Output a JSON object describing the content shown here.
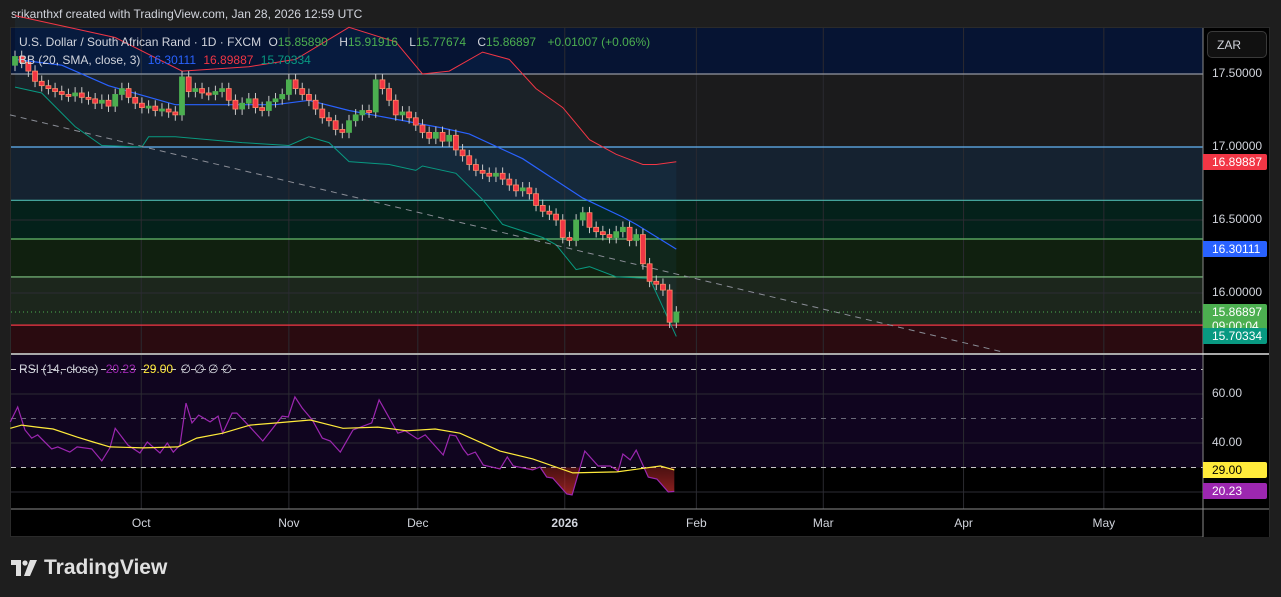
{
  "credit": "srikanthxf created with TradingView.com, Jan 28, 2026 12:59 UTC",
  "logo_text": "TradingView",
  "currency_button": "ZAR",
  "legend": {
    "symbol": "U.S. Dollar / South African Rand · 1D · FXCM",
    "o_label": "O",
    "o": "15.85890",
    "h_label": "H",
    "h": "15.91916",
    "l_label": "L",
    "l": "15.77674",
    "c_label": "C",
    "c": "15.86897",
    "change": "+0.01007 (+0.06%)",
    "bb_label": "BB (20, SMA, close, 3)",
    "bb_basis": "16.30111",
    "bb_upper": "16.89887",
    "bb_lower": "15.70334",
    "rsi_label": "RSI (14, close)",
    "rsi_value": "20.23",
    "rsi_ma": "29.00",
    "rsi_extra": "∅ ∅ ∅ ∅"
  },
  "colors": {
    "up": "#4caf50",
    "down": "#f23645",
    "down_border": "#ff8a65",
    "bb_basis": "#2962ff",
    "bb_upper": "#f23645",
    "bb_lower": "#089981",
    "rsi": "#9c27b0",
    "rsi_ma": "#ffeb3b",
    "last": "#4caf50"
  },
  "price_axis": {
    "ticks": [
      "17.50000",
      "17.00000",
      "16.50000",
      "16.00000"
    ],
    "tick_values": [
      17.5,
      17.0,
      16.5,
      16.0
    ]
  },
  "price_badges": [
    {
      "text": "16.89887",
      "value": 16.89887,
      "color": "#f23645"
    },
    {
      "text": "16.30111",
      "value": 16.30111,
      "color": "#2962ff"
    },
    {
      "text": "15.86897",
      "value": 15.86897,
      "color": "#4caf50",
      "sub": "09:00:04"
    },
    {
      "text": "15.70334",
      "value": 15.70334,
      "color": "#089981"
    }
  ],
  "rsi_axis": {
    "ticks": [
      "60.00",
      "40.00"
    ],
    "tick_values": [
      60,
      40
    ]
  },
  "rsi_badges": [
    {
      "text": "29.00",
      "value": 29.0,
      "color": "#ffeb3b",
      "fg": "#000"
    },
    {
      "text": "20.23",
      "value": 20.23,
      "color": "#9c27b0",
      "fg": "#fff"
    }
  ],
  "time_axis": [
    {
      "label": "Oct",
      "bar": 18.9
    },
    {
      "label": "Nov",
      "bar": 41
    },
    {
      "label": "Dec",
      "bar": 60.3
    },
    {
      "label": "2026",
      "bar": 82.3,
      "bold": true
    },
    {
      "label": "Feb",
      "bar": 102
    },
    {
      "label": "Mar",
      "bar": 121
    },
    {
      "label": "Apr",
      "bar": 142
    },
    {
      "label": "May",
      "bar": 163
    }
  ],
  "chart_data": {
    "type": "candlestick",
    "title": "U.S. Dollar / South African Rand · 1D · FXCM",
    "ylim": [
      15.6,
      17.83
    ],
    "first_open": 17.56,
    "wick": 0.04,
    "close": [
      17.62,
      17.58,
      17.52,
      17.45,
      17.42,
      17.4,
      17.38,
      17.36,
      17.35,
      17.37,
      17.34,
      17.33,
      17.3,
      17.32,
      17.28,
      17.36,
      17.4,
      17.34,
      17.3,
      17.27,
      17.28,
      17.25,
      17.26,
      17.24,
      17.22,
      17.48,
      17.38,
      17.4,
      17.37,
      17.36,
      17.38,
      17.4,
      17.32,
      17.26,
      17.3,
      17.33,
      17.27,
      17.25,
      17.31,
      17.33,
      17.36,
      17.46,
      17.4,
      17.36,
      17.32,
      17.26,
      17.2,
      17.18,
      17.12,
      17.1,
      17.18,
      17.22,
      17.25,
      17.24,
      17.46,
      17.4,
      17.32,
      17.22,
      17.24,
      17.2,
      17.15,
      17.1,
      17.06,
      17.1,
      17.04,
      17.08,
      16.98,
      16.94,
      16.88,
      16.84,
      16.82,
      16.8,
      16.82,
      16.78,
      16.74,
      16.7,
      16.72,
      16.68,
      16.6,
      16.56,
      16.54,
      16.5,
      16.38,
      16.36,
      16.5,
      16.55,
      16.45,
      16.42,
      16.4,
      16.38,
      16.42,
      16.45,
      16.36,
      16.4,
      16.2,
      16.08,
      16.06,
      16.02,
      15.8,
      15.87
    ],
    "bb_upper": [
      [
        0,
        17.9
      ],
      [
        15,
        17.75
      ],
      [
        25,
        17.52
      ],
      [
        35,
        17.55
      ],
      [
        42,
        17.6
      ],
      [
        50,
        17.82
      ],
      [
        57,
        17.72
      ],
      [
        61,
        17.5
      ],
      [
        65,
        17.52
      ],
      [
        70,
        17.65
      ],
      [
        74,
        17.6
      ],
      [
        78,
        17.4
      ],
      [
        82,
        17.27
      ],
      [
        86,
        17.05
      ],
      [
        90,
        16.95
      ],
      [
        94,
        16.88
      ],
      [
        96,
        16.88
      ],
      [
        99,
        16.899
      ]
    ],
    "bb_basis": [
      [
        0,
        17.6
      ],
      [
        7,
        17.56
      ],
      [
        14,
        17.42
      ],
      [
        24,
        17.29
      ],
      [
        39,
        17.29
      ],
      [
        44,
        17.32
      ],
      [
        50,
        17.25
      ],
      [
        64,
        17.13
      ],
      [
        68,
        17.09
      ],
      [
        76,
        16.92
      ],
      [
        81,
        16.77
      ],
      [
        85,
        16.65
      ],
      [
        91,
        16.52
      ],
      [
        93,
        16.47
      ],
      [
        99,
        16.301
      ]
    ],
    "bb_lower": [
      [
        0,
        17.41
      ],
      [
        4,
        17.37
      ],
      [
        9,
        17.14
      ],
      [
        13,
        17.01
      ],
      [
        19,
        17.0
      ],
      [
        20,
        17.07
      ],
      [
        24,
        17.07
      ],
      [
        34,
        17.03
      ],
      [
        41,
        17.01
      ],
      [
        44,
        17.07
      ],
      [
        47,
        17.03
      ],
      [
        50,
        16.9
      ],
      [
        56,
        16.88
      ],
      [
        60,
        16.84
      ],
      [
        61,
        16.87
      ],
      [
        66,
        16.82
      ],
      [
        70,
        16.64
      ],
      [
        73,
        16.47
      ],
      [
        79,
        16.38
      ],
      [
        81,
        16.33
      ],
      [
        84,
        16.16
      ],
      [
        86,
        16.18
      ],
      [
        90,
        16.11
      ],
      [
        95,
        16.1
      ],
      [
        99,
        15.703
      ]
    ],
    "trendline": [
      [
        -0.75,
        17.22
      ],
      [
        147.5,
        15.6
      ]
    ],
    "fib_levels": [
      {
        "price": 17.5,
        "line": "#9598a1",
        "fill_above": "#061433"
      },
      {
        "price": 17.0,
        "line": "#64b5f6",
        "fill_above": "#1b1b1c"
      },
      {
        "price": 16.635,
        "line": "#4db6ac",
        "fill_above": "#152230"
      },
      {
        "price": 16.37,
        "line": "#66bb6a",
        "fill_above": "#04211a"
      },
      {
        "price": 16.11,
        "line": "#81c784",
        "fill_above": "#10200f"
      },
      {
        "price": 15.78,
        "line": "#f23645",
        "fill_above": "#1c261c",
        "fill_below": "#2a0b10"
      }
    ],
    "rsi": [
      [
        -0.7,
        48.6
      ],
      [
        0.4,
        54.7
      ],
      [
        1.5,
        45.3
      ],
      [
        2.5,
        42
      ],
      [
        3.4,
        43.3
      ],
      [
        5.5,
        37.6
      ],
      [
        6.4,
        38.4
      ],
      [
        8.2,
        36.3
      ],
      [
        9.3,
        38.4
      ],
      [
        11.5,
        37.6
      ],
      [
        13,
        32.7
      ],
      [
        14.2,
        38
      ],
      [
        15,
        46
      ],
      [
        16.9,
        39.2
      ],
      [
        18.7,
        35.9
      ],
      [
        19.8,
        40.4
      ],
      [
        21.7,
        35.9
      ],
      [
        22.8,
        40
      ],
      [
        23.7,
        36.3
      ],
      [
        24.7,
        39.2
      ],
      [
        25.6,
        56.3
      ],
      [
        26.5,
        48.2
      ],
      [
        27.5,
        51.4
      ],
      [
        29.2,
        48.6
      ],
      [
        30.4,
        51
      ],
      [
        31.1,
        44
      ],
      [
        32.5,
        52.2
      ],
      [
        33.2,
        52.2
      ],
      [
        35.2,
        46.5
      ],
      [
        37.1,
        40.8
      ],
      [
        38.6,
        46
      ],
      [
        40,
        51
      ],
      [
        40.9,
        50.6
      ],
      [
        41.9,
        58.8
      ],
      [
        43,
        54.3
      ],
      [
        44.5,
        49.4
      ],
      [
        46,
        42
      ],
      [
        47.2,
        40.8
      ],
      [
        48.7,
        36.3
      ],
      [
        50.6,
        45.3
      ],
      [
        53.4,
        48.2
      ],
      [
        54.5,
        57.6
      ],
      [
        57.3,
        44
      ],
      [
        58.4,
        45
      ],
      [
        60.3,
        41.6
      ],
      [
        61.4,
        43.3
      ],
      [
        64.1,
        35.1
      ],
      [
        65.1,
        43.3
      ],
      [
        66,
        42.9
      ],
      [
        67.1,
        37.6
      ],
      [
        67.8,
        35.1
      ],
      [
        68.9,
        36.3
      ],
      [
        70.1,
        31
      ],
      [
        72.6,
        29.4
      ],
      [
        73.7,
        34.3
      ],
      [
        74.6,
        30.6
      ],
      [
        77.5,
        29
      ],
      [
        78.6,
        30.2
      ],
      [
        79.6,
        26.1
      ],
      [
        80.5,
        25.7
      ],
      [
        82.6,
        19.2
      ],
      [
        83.4,
        18.8
      ],
      [
        85.3,
        36.7
      ],
      [
        87.3,
        30.6
      ],
      [
        89.1,
        30.6
      ],
      [
        90.3,
        28.6
      ],
      [
        91,
        35.5
      ],
      [
        92.1,
        33.1
      ],
      [
        93,
        37.1
      ],
      [
        94.8,
        26.1
      ],
      [
        96.1,
        25.3
      ],
      [
        97.8,
        20
      ],
      [
        98.7,
        20.23
      ]
    ],
    "rsi_ma": [
      [
        -0.7,
        46
      ],
      [
        1,
        47.3
      ],
      [
        3.3,
        46.5
      ],
      [
        5.7,
        45.7
      ],
      [
        9.3,
        42.4
      ],
      [
        11.7,
        40.4
      ],
      [
        14.2,
        38.4
      ],
      [
        19.2,
        38
      ],
      [
        24.4,
        38.4
      ],
      [
        27.2,
        42
      ],
      [
        31.1,
        44
      ],
      [
        35.2,
        47.3
      ],
      [
        39.2,
        48.2
      ],
      [
        44.2,
        49.4
      ],
      [
        49.1,
        46
      ],
      [
        54.3,
        46.5
      ],
      [
        58.7,
        45
      ],
      [
        62.9,
        45.7
      ],
      [
        66.6,
        44
      ],
      [
        72.6,
        36.7
      ],
      [
        77.5,
        33.5
      ],
      [
        83.5,
        27.8
      ],
      [
        90.1,
        28.2
      ],
      [
        96.6,
        30.6
      ],
      [
        98.7,
        29
      ]
    ],
    "rsi_levels": {
      "upper": 70,
      "middle": 50,
      "lower": 30
    },
    "rsi_ylim": [
      14,
      84
    ]
  }
}
